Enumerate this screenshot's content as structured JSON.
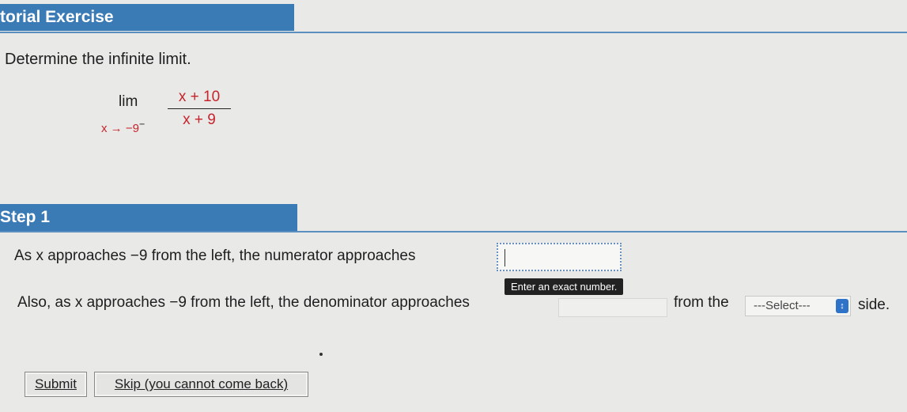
{
  "header": {
    "title": "torial Exercise"
  },
  "prompt": "Determine the infinite limit.",
  "math": {
    "lim_word": "lim",
    "lim_sub": "x → −9",
    "lim_sup": "−",
    "numerator": "x + 10",
    "denominator": "x + 9"
  },
  "step": {
    "title": "Step 1",
    "line1": "As x approaches −9 from the left, the numerator approaches",
    "tooltip": "Enter an exact number.",
    "line2": "Also, as x approaches −9 from the left, the denominator approaches",
    "from_the": "from the",
    "select_value": "---Select---",
    "side": "side."
  },
  "buttons": {
    "submit": "Submit",
    "skip": "Skip (you cannot come back)"
  },
  "colors": {
    "bar": "#3a7bb6",
    "math_red": "#c8232c"
  }
}
